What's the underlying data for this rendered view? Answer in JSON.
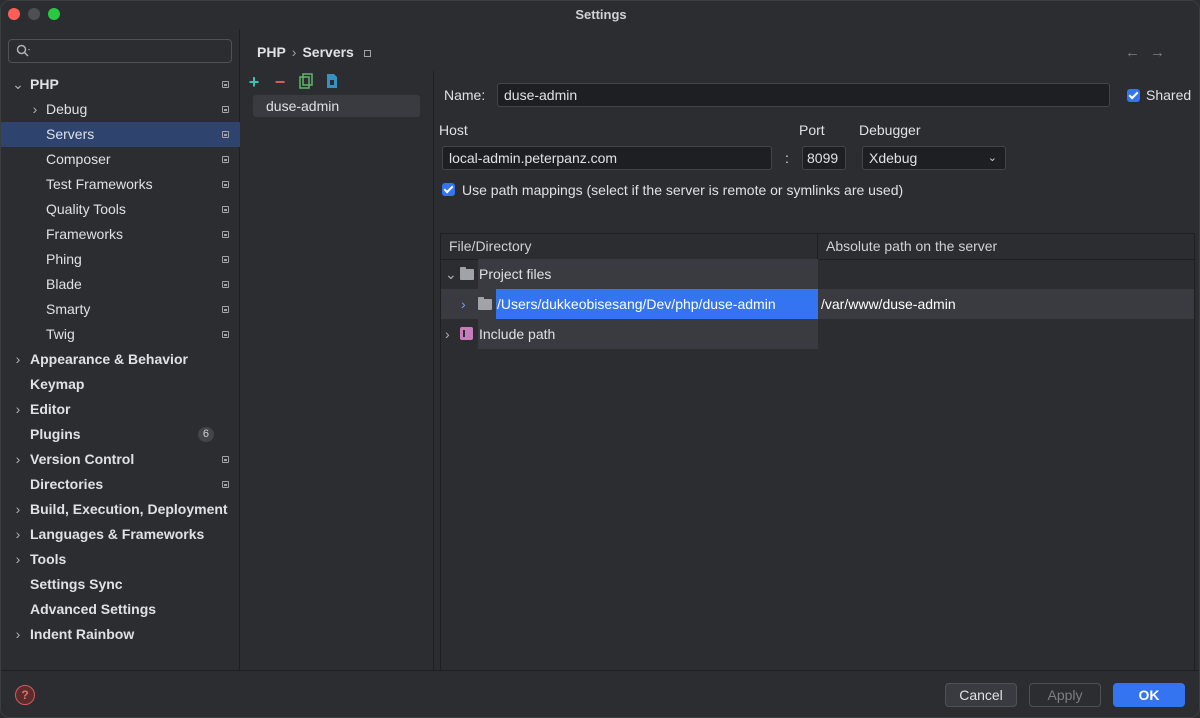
{
  "window": {
    "title": "Settings"
  },
  "search": {
    "placeholder": ""
  },
  "sidebar": {
    "items": [
      {
        "label": "PHP",
        "bold": true,
        "expanded": true,
        "pinned": true
      },
      {
        "label": "Debug",
        "child": true,
        "collapsed": true,
        "pinned": true
      },
      {
        "label": "Servers",
        "child": true,
        "selected": true,
        "pinned": true
      },
      {
        "label": "Composer",
        "child": true,
        "pinned": true
      },
      {
        "label": "Test Frameworks",
        "child": true,
        "pinned": true
      },
      {
        "label": "Quality Tools",
        "child": true,
        "pinned": true
      },
      {
        "label": "Frameworks",
        "child": true,
        "pinned": true
      },
      {
        "label": "Phing",
        "child": true,
        "pinned": true
      },
      {
        "label": "Blade",
        "child": true,
        "pinned": true
      },
      {
        "label": "Smarty",
        "child": true,
        "pinned": true
      },
      {
        "label": "Twig",
        "child": true,
        "pinned": true
      },
      {
        "label": "Appearance & Behavior",
        "bold": true,
        "collapsed": true
      },
      {
        "label": "Keymap",
        "bold": true
      },
      {
        "label": "Editor",
        "bold": true,
        "collapsed": true
      },
      {
        "label": "Plugins",
        "bold": true,
        "count": "6"
      },
      {
        "label": "Version Control",
        "bold": true,
        "collapsed": true,
        "pinned": true
      },
      {
        "label": "Directories",
        "bold": true,
        "pinned": true
      },
      {
        "label": "Build, Execution, Deployment",
        "bold": true,
        "collapsed": true
      },
      {
        "label": "Languages & Frameworks",
        "bold": true,
        "collapsed": true
      },
      {
        "label": "Tools",
        "bold": true,
        "collapsed": true
      },
      {
        "label": "Settings Sync",
        "bold": true
      },
      {
        "label": "Advanced Settings",
        "bold": true
      },
      {
        "label": "Indent Rainbow",
        "bold": true,
        "collapsed": true
      }
    ]
  },
  "breadcrumb": {
    "parent": "PHP",
    "separator": "›",
    "current": "Servers"
  },
  "servers": {
    "items": [
      "duse-admin"
    ]
  },
  "form": {
    "name_label": "Name:",
    "name_value": "duse-admin",
    "shared_label": "Shared",
    "shared_checked": true,
    "host_label": "Host",
    "host_value": "local-admin.peterpanz.com",
    "colon": ":",
    "port_label": "Port",
    "port_value": "8099",
    "debugger_label": "Debugger",
    "debugger_value": "Xdebug",
    "mappings_label": "Use path mappings (select if the server is remote or symlinks are used)",
    "mappings_checked": true
  },
  "mappings_table": {
    "columns": [
      "File/Directory",
      "Absolute path on the server"
    ],
    "rows": [
      {
        "label": "Project files",
        "expanded": true
      },
      {
        "label": "/Users/dukkeobisesang/Dev/php/duse-admin",
        "server_path": "/var/www/duse-admin",
        "selected": true
      },
      {
        "label": "Include path",
        "collapsed": true
      }
    ]
  },
  "footer": {
    "help": "?",
    "cancel": "Cancel",
    "apply": "Apply",
    "ok": "OK"
  },
  "colors": {
    "accent": "#3574f0",
    "selection": "#2e436e",
    "background": "#2b2d30"
  }
}
